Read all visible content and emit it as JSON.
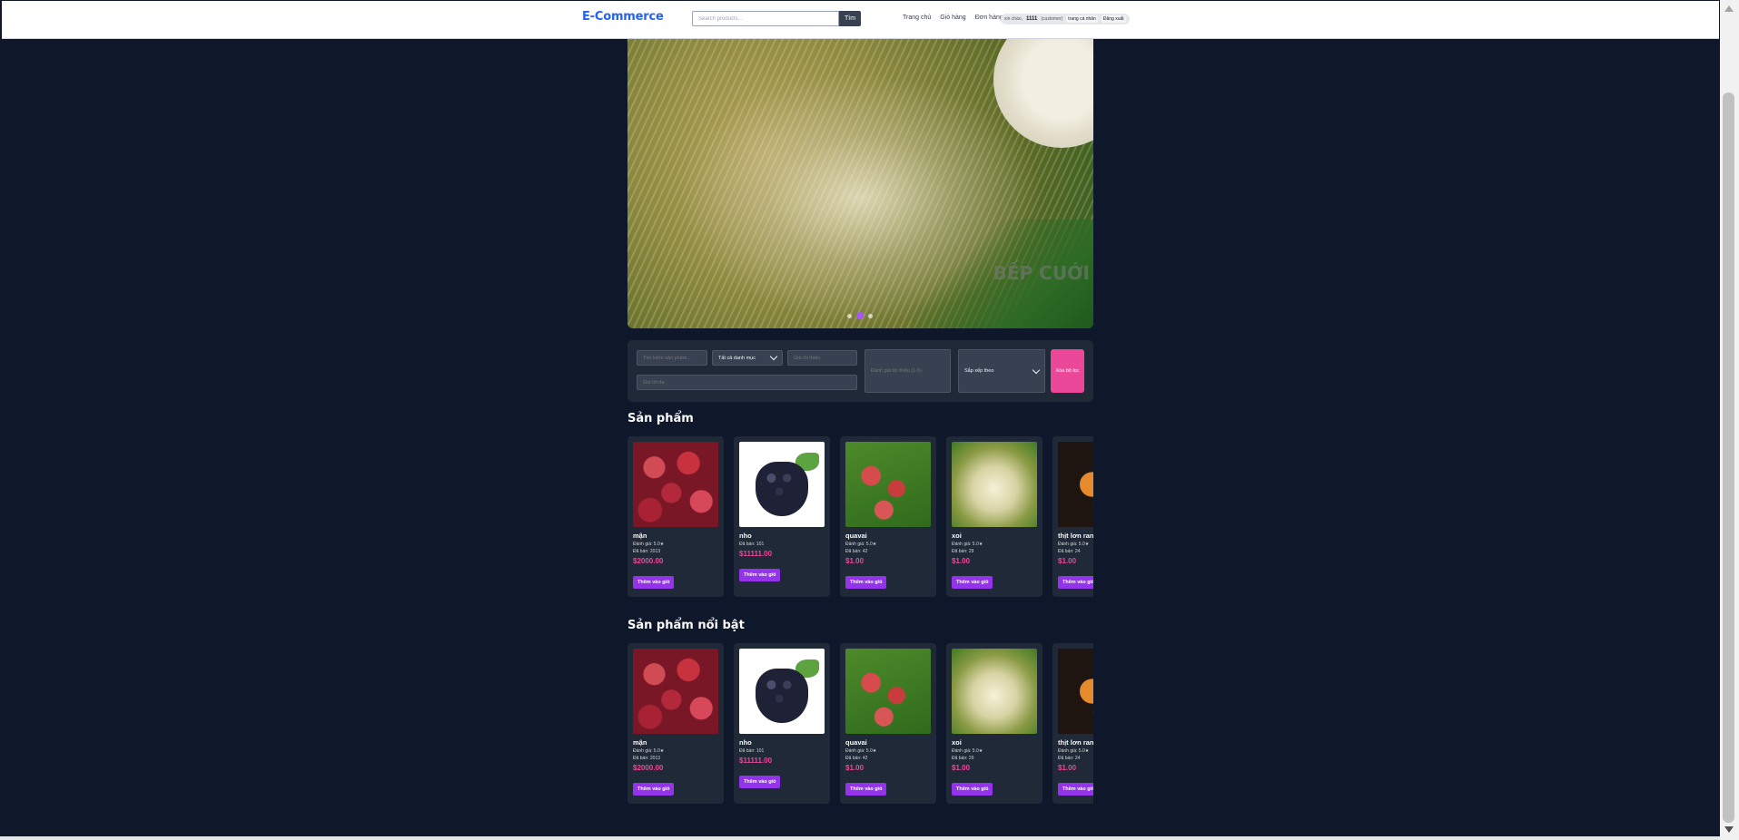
{
  "header": {
    "brand": "E-Commerce",
    "search_placeholder": "Search products...",
    "search_button": "Tìm",
    "nav": [
      "Trang chủ",
      "Giỏ hàng",
      "Đơn hàng"
    ],
    "greeting": "xin chào,",
    "username": "1111",
    "role": "(customer)",
    "profile_button": "trang cá nhân",
    "logout_button": "Đăng xuất"
  },
  "hero": {
    "watermark": "BẾP CUỚI",
    "slides_count": 3,
    "active_slide": 2
  },
  "filters": {
    "search_placeholder": "Tìm kiếm sản phẩm...",
    "category_value": "Tất cả danh mục",
    "min_price_placeholder": "Giá tối thiểu",
    "max_price_placeholder": "Giá tối đa",
    "rating_placeholder": "Đánh giá tối thiểu (1-5)",
    "sort_value": "Sắp xếp theo",
    "clear_button": "Xóa bộ lọc"
  },
  "sections": {
    "products_title": "Sản phẩm",
    "featured_title": "Sản phẩm nổi bật"
  },
  "add_to_cart": "Thêm vào giỏ",
  "products": [
    {
      "name": "mận",
      "rating": "Đánh giá: 5.0★",
      "sold": "Đã bán: 2013",
      "price": "$2000.00",
      "img": "plum"
    },
    {
      "name": "nho",
      "rating": "",
      "sold": "Đã bán: 101",
      "price": "$11111.00",
      "img": "grape"
    },
    {
      "name": "quavai",
      "rating": "Đánh giá: 5.0★",
      "sold": "Đã bán: 42",
      "price": "$1.00",
      "img": "lychee"
    },
    {
      "name": "xoi",
      "rating": "Đánh giá: 5.0★",
      "sold": "Đã bán: 29",
      "price": "$1.00",
      "img": "xoi"
    },
    {
      "name": "thịt lơn ran...",
      "rating": "Đánh giá: 5.0★",
      "sold": "Đã bán: 24",
      "price": "$1.00",
      "img": "meat"
    }
  ],
  "colors": {
    "background": "#0f172a",
    "brand": "#2563eb",
    "accent": "#9333ea",
    "price": "#ec4899"
  }
}
